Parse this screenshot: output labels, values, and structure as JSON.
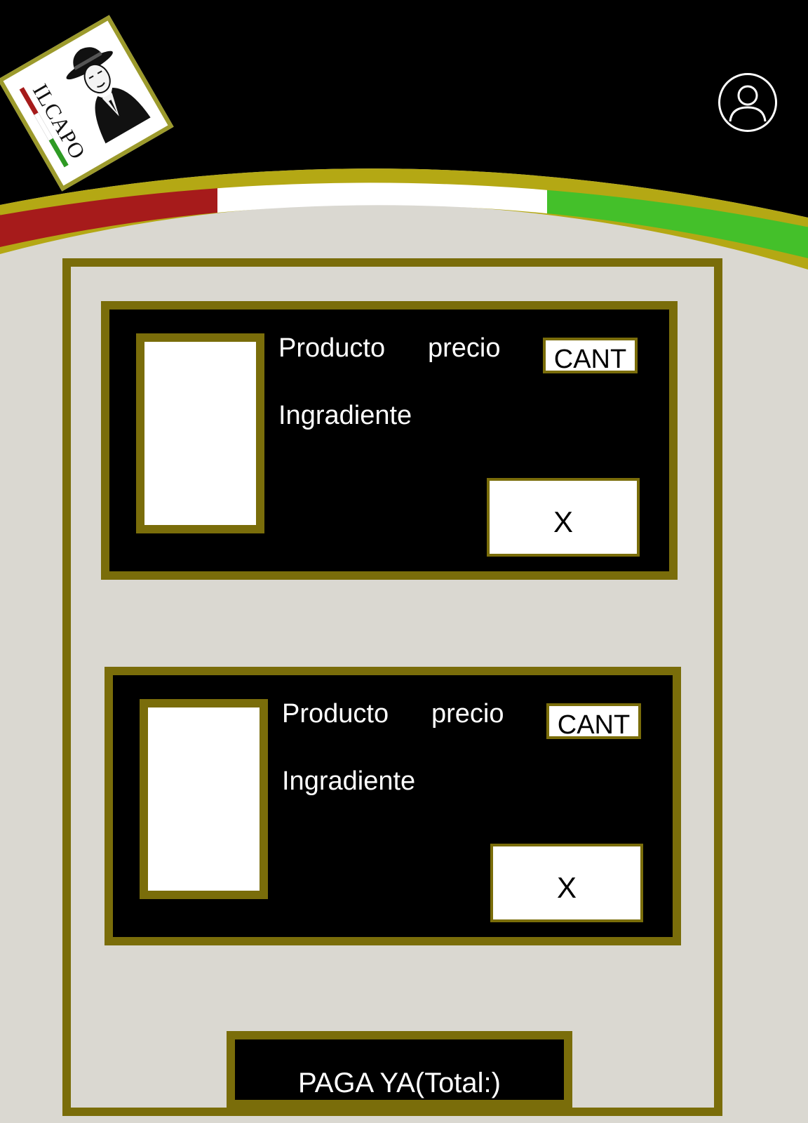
{
  "brand": {
    "logo_text": "ILCAPO"
  },
  "header": {
    "profile_icon": "user-profile-icon"
  },
  "cart": {
    "items": [
      {
        "name_label": "Producto",
        "price_label": "precio",
        "ingredient_label": "Ingradiente",
        "qty_label": "CANT",
        "remove_label": "X"
      },
      {
        "name_label": "Producto",
        "price_label": "precio",
        "ingredient_label": "Ingradiente",
        "qty_label": "CANT",
        "remove_label": "X"
      }
    ],
    "pay_label": "PAGA YA(Total:)"
  },
  "colors": {
    "header_bg": "#000000",
    "page_bg": "#dad8d1",
    "frame": "#7a6d0a",
    "gold_stripe": "#b4a814",
    "italian_red": "#a61b1b",
    "italian_white": "#ffffff",
    "italian_green": "#44c02a"
  }
}
